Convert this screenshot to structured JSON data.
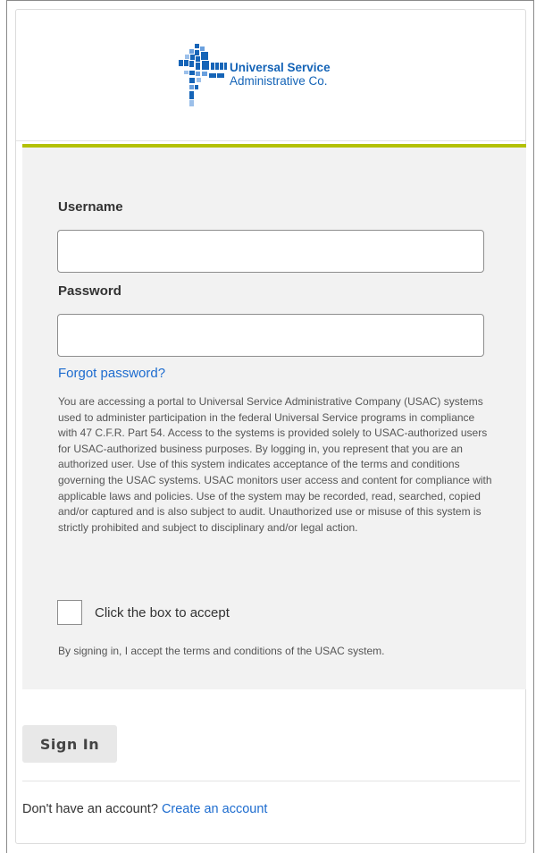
{
  "brand": {
    "name_line1": "Universal Service",
    "name_line2": "Administrative Co.",
    "logo_icon": "usac-logo-icon",
    "brand_color": "#1564b7",
    "accent_color": "#b3c106",
    "link_color": "#1d6ccf"
  },
  "form": {
    "username_label": "Username",
    "username_value": "",
    "password_label": "Password",
    "password_value": "",
    "forgot_link": "Forgot password?",
    "disclaimer": "You are accessing a portal to Universal Service Administrative Company (USAC) systems used to administer participation in the federal Universal Service programs in compliance with 47 C.F.R. Part 54. Access to the systems is provided solely to USAC-authorized users for USAC-authorized business purposes. By logging in, you represent that you are an authorized user. Use of this system indicates acceptance of the terms and conditions governing the USAC systems. USAC monitors user access and content for compliance with applicable laws and policies. Use of the system may be recorded, read, searched, copied and/or captured and is also subject to audit. Unauthorized use or misuse of this system is strictly prohibited and subject to disciplinary and/or legal action.",
    "accept_checkbox_label": "Click the box to accept",
    "accept_checked": false,
    "terms_note": "By signing in, I accept the terms and conditions of the USAC system."
  },
  "actions": {
    "signin_label": "Sign In"
  },
  "footer": {
    "prompt": "Don't have an account?",
    "create_link": "Create an account"
  }
}
